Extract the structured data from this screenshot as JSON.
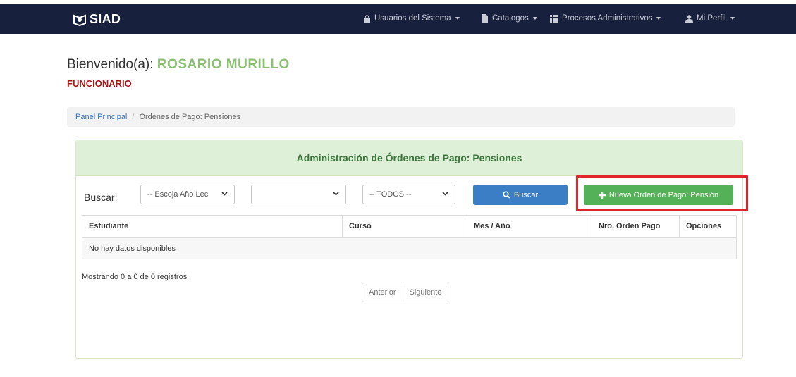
{
  "navbar": {
    "brand": "SIAD",
    "items": [
      {
        "label": "Usuarios del Sistema",
        "icon": "lock-icon"
      },
      {
        "label": "Catalogos",
        "icon": "file-icon"
      },
      {
        "label": "Procesos Administrativos",
        "icon": "list-icon"
      },
      {
        "label": "Mi Perfil",
        "icon": "user-icon"
      }
    ]
  },
  "welcome": {
    "prefix": "Bienvenido(a):",
    "user_name": "ROSARIO MURILLO",
    "role": "FUNCIONARIO"
  },
  "breadcrumb": {
    "home": "Panel Principal",
    "separator": "/",
    "current": "Ordenes de Pago: Pensiones"
  },
  "panel": {
    "title": "Administración de Órdenes de Pago: Pensiones",
    "search_label": "Buscar:",
    "select_year": "-- Escoja Año Lec",
    "select_course": "",
    "select_status": "-- TODOS --",
    "buscar_button": "Buscar",
    "nueva_button": "Nueva Orden de Pago: Pensión"
  },
  "table": {
    "columns": [
      "Estudiante",
      "Curso",
      "Mes / Año",
      "Nro. Orden Pago",
      "Opciones"
    ],
    "empty_message": "No hay datos disponibles"
  },
  "footer": {
    "info": "Mostrando 0 a 0 de 0 registros",
    "prev": "Anterior",
    "next": "Siguiente"
  },
  "colors": {
    "navbar": "#17203d",
    "user_name": "#8bbf72",
    "role": "#a01818",
    "panel_heading_bg": "#dff0d8",
    "panel_heading_text": "#3c763d",
    "btn_primary": "#3b7ec6",
    "btn_success": "#54b157",
    "highlight": "#e0242b"
  }
}
